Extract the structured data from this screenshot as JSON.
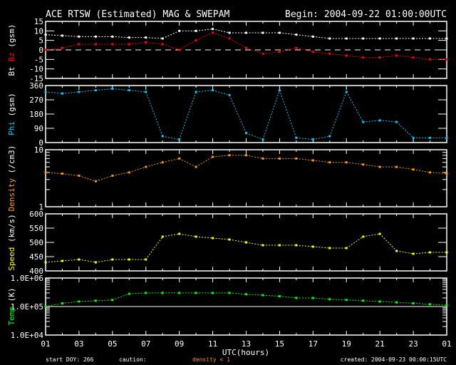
{
  "chart_data": {
    "type": "scatter",
    "title": "ACE RTSW (Estimated) MAG & SWEPAM",
    "begin": "Begin: 2004-09-22 01:00:00UTC",
    "xlabel": "UTC(hours)",
    "x_ticks": [
      "01",
      "03",
      "05",
      "07",
      "09",
      "11",
      "13",
      "15",
      "17",
      "19",
      "21",
      "23",
      "01"
    ],
    "x_hours": [
      0,
      1,
      2,
      3,
      4,
      5,
      6,
      7,
      8,
      9,
      10,
      11,
      12,
      13,
      14,
      15,
      16,
      17,
      18,
      19,
      20,
      21,
      22,
      23,
      24
    ],
    "xlim": [
      0,
      24
    ],
    "footer": {
      "start_doy": "start DOY: 266",
      "caution": "caution:",
      "caution_note": "density < 1",
      "created": "created: 2004-09-23 00:00:15UTC"
    },
    "panels": [
      {
        "id": "mag",
        "ylabel_parts": [
          {
            "text": "Bt",
            "color": "#ffffff"
          },
          {
            "text": " Bz",
            "color": "#ff0000"
          },
          {
            "text": " (gsm)",
            "color": "#ffffff"
          }
        ],
        "ylim": [
          -15,
          15
        ],
        "log": false,
        "ticks": [
          {
            "v": 15,
            "l": "15"
          },
          {
            "v": 10,
            "l": "10"
          },
          {
            "v": 5,
            "l": "5"
          },
          {
            "v": 0,
            "l": "0"
          },
          {
            "v": -5,
            "l": "-5"
          },
          {
            "v": -10,
            "l": "-10"
          },
          {
            "v": -15,
            "l": "-15"
          }
        ],
        "refline": {
          "value": 0,
          "style": "dashed"
        },
        "series": [
          {
            "name": "Bt",
            "color": "#ffffff",
            "values": [
              8,
              7.5,
              7,
              7,
              7,
              6.5,
              6.5,
              6,
              10,
              10,
              11,
              9,
              9,
              9,
              9,
              8,
              7,
              6,
              6,
              6,
              6,
              6,
              6,
              6,
              6
            ]
          },
          {
            "name": "Bz",
            "color": "#ff0000",
            "values": [
              0,
              1,
              3,
              3,
              3,
              3,
              4,
              3,
              0,
              5,
              9,
              6,
              1,
              -2,
              -1,
              1,
              -1,
              -2,
              -3,
              -4,
              -4,
              -3,
              -4,
              -5,
              -5
            ]
          }
        ]
      },
      {
        "id": "phi",
        "ylabel_parts": [
          {
            "text": "Phi",
            "color": "#00c8ff"
          },
          {
            "text": " (gsm)",
            "color": "#ffffff"
          }
        ],
        "ylim": [
          0,
          360
        ],
        "log": false,
        "ticks": [
          {
            "v": 360,
            "l": "360"
          },
          {
            "v": 270,
            "l": "270"
          },
          {
            "v": 180,
            "l": "180"
          },
          {
            "v": 90,
            "l": "90"
          },
          {
            "v": 0,
            "l": "0"
          }
        ],
        "series": [
          {
            "name": "Phi",
            "color": "#00c8ff",
            "values": [
              320,
              310,
              320,
              330,
              340,
              330,
              320,
              40,
              20,
              320,
              330,
              300,
              60,
              20,
              330,
              30,
              20,
              40,
              320,
              130,
              140,
              130,
              30,
              30,
              30
            ]
          }
        ]
      },
      {
        "id": "density",
        "ylabel_parts": [
          {
            "text": "Density",
            "color": "#ff9900"
          },
          {
            "text": " (/cm3)",
            "color": "#ffffff"
          }
        ],
        "ylim": [
          1,
          10
        ],
        "log": true,
        "ticks": [
          {
            "v": 10,
            "l": "10"
          },
          {
            "v": 1,
            "l": "1"
          }
        ],
        "series": [
          {
            "name": "Density",
            "color": "#ff9900",
            "values": [
              4,
              3.8,
              3.5,
              2.8,
              3.5,
              4,
              5,
              6,
              7,
              5,
              7.5,
              8,
              8,
              7,
              7,
              7,
              6.5,
              6,
              6,
              5.5,
              5,
              5,
              4.5,
              4,
              3.8
            ]
          }
        ]
      },
      {
        "id": "speed",
        "ylabel_parts": [
          {
            "text": "Speed",
            "color": "#ffff00"
          },
          {
            "text": " (km/s)",
            "color": "#ffffff"
          }
        ],
        "ylim": [
          400,
          600
        ],
        "log": false,
        "ticks": [
          {
            "v": 600,
            "l": "600"
          },
          {
            "v": 550,
            "l": "550"
          },
          {
            "v": 500,
            "l": "500"
          },
          {
            "v": 450,
            "l": "450"
          },
          {
            "v": 400,
            "l": "400"
          }
        ],
        "series": [
          {
            "name": "Speed",
            "color": "#ffff00",
            "values": [
              430,
              435,
              440,
              430,
              440,
              440,
              440,
              520,
              530,
              520,
              515,
              510,
              500,
              490,
              490,
              490,
              485,
              480,
              480,
              520,
              530,
              470,
              460,
              465,
              465
            ]
          }
        ]
      },
      {
        "id": "temp",
        "ylabel_parts": [
          {
            "text": "Temp",
            "color": "#00ff00"
          },
          {
            "text": " (K)",
            "color": "#ffffff"
          }
        ],
        "ylim": [
          10000,
          1000000
        ],
        "log": true,
        "ticks": [
          {
            "v": 1000000,
            "l": "1.0E+06"
          },
          {
            "v": 100000,
            "l": "1.0E+05"
          },
          {
            "v": 10000,
            "l": "1.0E+04"
          }
        ],
        "refline": {
          "value": 100000,
          "style": "solid"
        },
        "series": [
          {
            "name": "Temp",
            "color": "#00ff00",
            "values": [
              100000,
              130000,
              150000,
              160000,
              170000,
              280000,
              300000,
              300000,
              300000,
              300000,
              300000,
              300000,
              270000,
              250000,
              230000,
              200000,
              200000,
              180000,
              170000,
              160000,
              150000,
              140000,
              130000,
              120000,
              110000
            ]
          }
        ]
      }
    ]
  }
}
